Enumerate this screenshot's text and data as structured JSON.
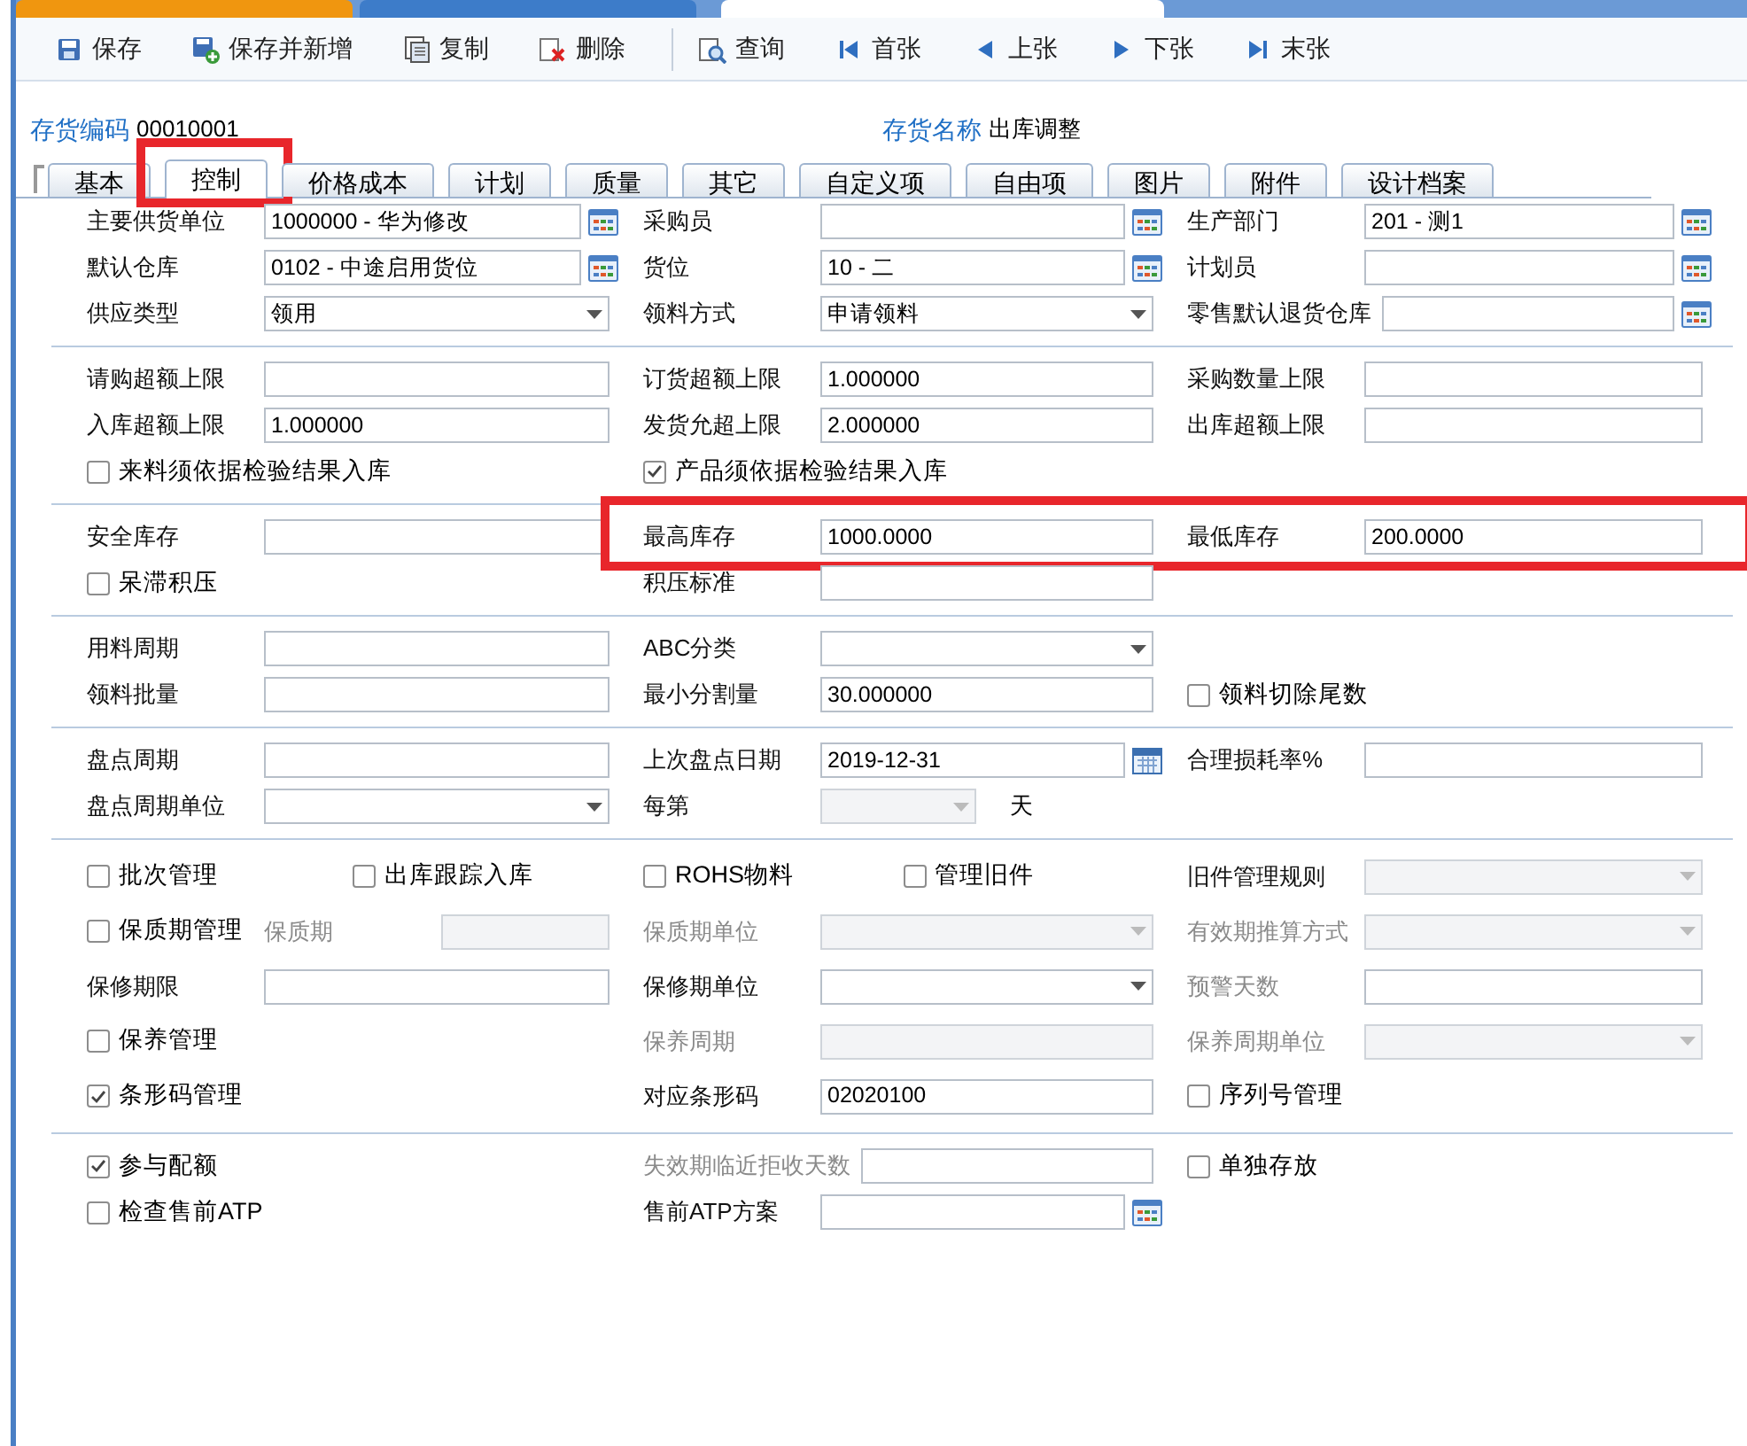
{
  "top_tabs": [
    {
      "color": "#f0960f",
      "selected": false
    },
    {
      "color": "#3d7cc9",
      "selected": false
    },
    {
      "selected": true
    }
  ],
  "toolbar": [
    [
      {
        "label": "保存"
      },
      {
        "label": "保存并新增"
      },
      {
        "label": "复制"
      },
      {
        "label": "删除"
      }
    ],
    [
      {
        "label": "查询"
      },
      {
        "label": "首张"
      },
      {
        "label": "上张"
      },
      {
        "label": "下张"
      },
      {
        "label": "末张"
      }
    ]
  ],
  "header": [
    {
      "label": "存货编码",
      "value": "00010001"
    },
    {
      "label": "存货名称",
      "value": "出库调整"
    }
  ],
  "tabs": [
    {
      "label": "基本",
      "selected": false,
      "highlighted": false
    },
    {
      "label": "控制",
      "selected": true,
      "highlighted": true
    },
    {
      "label": "价格成本",
      "selected": false,
      "highlighted": false
    },
    {
      "label": "计划",
      "selected": false,
      "highlighted": false
    },
    {
      "label": "质量",
      "selected": false,
      "highlighted": false
    },
    {
      "label": "其它",
      "selected": false,
      "highlighted": false
    },
    {
      "label": "自定义项",
      "selected": false,
      "highlighted": false
    },
    {
      "label": "自由项",
      "selected": false,
      "highlighted": false
    },
    {
      "label": "图片",
      "selected": false,
      "highlighted": false
    },
    {
      "label": "附件",
      "selected": false,
      "highlighted": false
    },
    {
      "label": "设计档案",
      "selected": false,
      "highlighted": false
    }
  ],
  "sections": [
    {
      "rows": [
        {
          "highlighted": false,
          "cells": [
            [
              {
                "kind": "label",
                "text": "主要供货单位",
                "disabled": false
              },
              {
                "kind": "lookup-input",
                "value": "1000000 - 华为修改",
                "disabled": false
              }
            ],
            [
              {
                "kind": "label",
                "text": "采购员",
                "disabled": false
              },
              {
                "kind": "lookup-input",
                "disabled": false
              }
            ],
            [
              {
                "kind": "label",
                "text": "生产部门",
                "disabled": false
              },
              {
                "kind": "lookup-input",
                "value": "201 - 测1",
                "disabled": false
              }
            ]
          ]
        },
        {
          "highlighted": false,
          "cells": [
            [
              {
                "kind": "label",
                "text": "默认仓库",
                "disabled": false
              },
              {
                "kind": "lookup-input",
                "value": "0102 - 中途启用货位",
                "disabled": false
              }
            ],
            [
              {
                "kind": "label",
                "text": "货位",
                "disabled": false
              },
              {
                "kind": "lookup-input",
                "value": "10 - 二",
                "disabled": false
              }
            ],
            [
              {
                "kind": "label",
                "text": "计划员",
                "disabled": false
              },
              {
                "kind": "lookup-input",
                "disabled": false
              }
            ]
          ]
        },
        {
          "highlighted": false,
          "cells": [
            [
              {
                "kind": "label",
                "text": "供应类型",
                "disabled": false
              },
              {
                "kind": "dropdown-input",
                "value": "领用",
                "disabled": false
              }
            ],
            [
              {
                "kind": "label",
                "text": "领料方式",
                "disabled": false
              },
              {
                "kind": "dropdown-input",
                "value": "申请领料",
                "disabled": false
              }
            ],
            [
              {
                "kind": "label",
                "text": "零售默认退货仓库",
                "disabled": false
              },
              {
                "kind": "lookup-input",
                "disabled": false
              }
            ]
          ]
        }
      ]
    },
    {
      "rows": [
        {
          "highlighted": false,
          "cells": [
            [
              {
                "kind": "label",
                "text": "请购超额上限",
                "disabled": false
              },
              {
                "kind": "text-input",
                "disabled": false
              }
            ],
            [
              {
                "kind": "label",
                "text": "订货超额上限",
                "disabled": false
              },
              {
                "kind": "text-input",
                "value": "1.000000",
                "disabled": false
              }
            ],
            [
              {
                "kind": "label",
                "text": "采购数量上限",
                "disabled": false
              },
              {
                "kind": "text-input",
                "disabled": false
              }
            ]
          ]
        },
        {
          "highlighted": false,
          "cells": [
            [
              {
                "kind": "label",
                "text": "入库超额上限",
                "disabled": false
              },
              {
                "kind": "text-input",
                "value": "1.000000",
                "disabled": false
              }
            ],
            [
              {
                "kind": "label",
                "text": "发货允超上限",
                "disabled": false
              },
              {
                "kind": "text-input",
                "value": "2.000000",
                "disabled": false
              }
            ],
            [
              {
                "kind": "label",
                "text": "出库超额上限",
                "disabled": false
              },
              {
                "kind": "text-input",
                "disabled": false
              }
            ]
          ]
        },
        {
          "highlighted": false,
          "cells": [
            [
              {
                "kind": "check",
                "label": "来料须依据检验结果入库",
                "checked": false
              }
            ],
            [
              {
                "kind": "check",
                "label": "产品须依据检验结果入库",
                "checked": true
              }
            ],
            []
          ]
        }
      ]
    },
    {
      "rows": [
        {
          "highlighted": true,
          "cells": [
            [
              {
                "kind": "label",
                "text": "安全库存",
                "disabled": false
              },
              {
                "kind": "text-input",
                "disabled": false
              }
            ],
            [
              {
                "kind": "label",
                "text": "最高库存",
                "disabled": false
              },
              {
                "kind": "text-input",
                "value": "1000.0000",
                "disabled": false
              }
            ],
            [
              {
                "kind": "label",
                "text": "最低库存",
                "disabled": false
              },
              {
                "kind": "text-input",
                "value": "200.0000",
                "disabled": false
              }
            ]
          ]
        },
        {
          "highlighted": false,
          "cells": [
            [
              {
                "kind": "check",
                "label": "呆滞积压",
                "checked": false
              }
            ],
            [
              {
                "kind": "label",
                "text": "积压标准",
                "disabled": false
              },
              {
                "kind": "text-input",
                "disabled": false
              }
            ],
            []
          ]
        }
      ]
    },
    {
      "rows": [
        {
          "highlighted": false,
          "cells": [
            [
              {
                "kind": "label",
                "text": "用料周期",
                "disabled": false
              },
              {
                "kind": "text-input",
                "disabled": false
              }
            ],
            [
              {
                "kind": "label",
                "text": "ABC分类",
                "disabled": false
              },
              {
                "kind": "dropdown-input",
                "disabled": false
              }
            ],
            []
          ]
        },
        {
          "highlighted": false,
          "cells": [
            [
              {
                "kind": "label",
                "text": "领料批量",
                "disabled": false
              },
              {
                "kind": "text-input",
                "disabled": false
              }
            ],
            [
              {
                "kind": "label",
                "text": "最小分割量",
                "disabled": false
              },
              {
                "kind": "text-input",
                "value": "30.000000",
                "disabled": false
              }
            ],
            [
              {
                "kind": "check",
                "label": "领料切除尾数",
                "checked": false
              }
            ]
          ]
        }
      ]
    },
    {
      "rows": [
        {
          "highlighted": false,
          "cells": [
            [
              {
                "kind": "label",
                "text": "盘点周期",
                "disabled": false
              },
              {
                "kind": "text-input",
                "disabled": false
              }
            ],
            [
              {
                "kind": "label",
                "text": "上次盘点日期",
                "disabled": false
              },
              {
                "kind": "date-input",
                "value": "2019-12-31",
                "disabled": false
              }
            ],
            [
              {
                "kind": "label",
                "text": "合理损耗率%",
                "disabled": false
              },
              {
                "kind": "text-input",
                "disabled": false
              }
            ]
          ]
        },
        {
          "highlighted": false,
          "cells": [
            [
              {
                "kind": "label",
                "text": "盘点周期单位",
                "disabled": false
              },
              {
                "kind": "dropdown-input",
                "disabled": false
              }
            ],
            [
              {
                "kind": "label",
                "text": "每第",
                "disabled": false
              },
              {
                "kind": "dropdown-input",
                "disabled": true
              },
              {
                "kind": "unit",
                "text": "天"
              }
            ],
            []
          ]
        }
      ]
    },
    {
      "rows": [
        {
          "highlighted": false,
          "cells": [
            [
              {
                "kind": "check",
                "label": "批次管理",
                "checked": false
              },
              {
                "kind": "check",
                "label": "出库跟踪入库",
                "checked": false
              }
            ],
            [
              {
                "kind": "check",
                "label": "ROHS物料",
                "checked": false
              },
              {
                "kind": "check",
                "label": "管理旧件",
                "checked": false
              }
            ],
            [
              {
                "kind": "label",
                "text": "旧件管理规则",
                "disabled": false
              },
              {
                "kind": "dropdown-input",
                "disabled": true
              }
            ]
          ]
        },
        {
          "highlighted": false,
          "cells": [
            [
              {
                "kind": "check",
                "label": "保质期管理",
                "checked": false
              },
              {
                "kind": "label",
                "text": "保质期",
                "disabled": true
              },
              {
                "kind": "text-input",
                "disabled": true
              }
            ],
            [
              {
                "kind": "label",
                "text": "保质期单位",
                "disabled": true
              },
              {
                "kind": "dropdown-input",
                "disabled": true
              }
            ],
            [
              {
                "kind": "label",
                "text": "有效期推算方式",
                "disabled": true
              },
              {
                "kind": "dropdown-input",
                "disabled": true
              }
            ]
          ]
        },
        {
          "highlighted": false,
          "cells": [
            [
              {
                "kind": "label",
                "text": "保修期限",
                "disabled": false
              },
              {
                "kind": "text-input",
                "disabled": false
              }
            ],
            [
              {
                "kind": "label",
                "text": "保修期单位",
                "disabled": false
              },
              {
                "kind": "dropdown-input",
                "disabled": false
              }
            ],
            [
              {
                "kind": "label",
                "text": "预警天数",
                "disabled": true
              },
              {
                "kind": "text-input",
                "disabled": false
              }
            ]
          ]
        },
        {
          "highlighted": false,
          "cells": [
            [
              {
                "kind": "check",
                "label": "保养管理",
                "checked": false
              }
            ],
            [
              {
                "kind": "label",
                "text": "保养周期",
                "disabled": true
              },
              {
                "kind": "text-input",
                "disabled": true
              }
            ],
            [
              {
                "kind": "label",
                "text": "保养周期单位",
                "disabled": true
              },
              {
                "kind": "dropdown-input",
                "disabled": true
              }
            ]
          ]
        },
        {
          "highlighted": false,
          "cells": [
            [
              {
                "kind": "check",
                "label": "条形码管理",
                "checked": true
              }
            ],
            [
              {
                "kind": "label",
                "text": "对应条形码",
                "disabled": false
              },
              {
                "kind": "text-input",
                "value": "02020100",
                "disabled": false
              }
            ],
            [
              {
                "kind": "check",
                "label": "序列号管理",
                "checked": false
              }
            ]
          ]
        }
      ]
    },
    {
      "rows": [
        {
          "highlighted": false,
          "cells": [
            [
              {
                "kind": "check",
                "label": "参与配额",
                "checked": true
              }
            ],
            [
              {
                "kind": "label",
                "text": "失效期临近拒收天数",
                "disabled": true
              },
              {
                "kind": "text-input",
                "disabled": false
              }
            ],
            [
              {
                "kind": "check",
                "label": "单独存放",
                "checked": false
              }
            ]
          ]
        },
        {
          "highlighted": false,
          "cells": [
            [
              {
                "kind": "check",
                "label": "检查售前ATP",
                "checked": false
              }
            ],
            [
              {
                "kind": "label",
                "text": "售前ATP方案",
                "disabled": false
              },
              {
                "kind": "lookup-input",
                "disabled": false
              }
            ],
            []
          ]
        }
      ]
    }
  ]
}
